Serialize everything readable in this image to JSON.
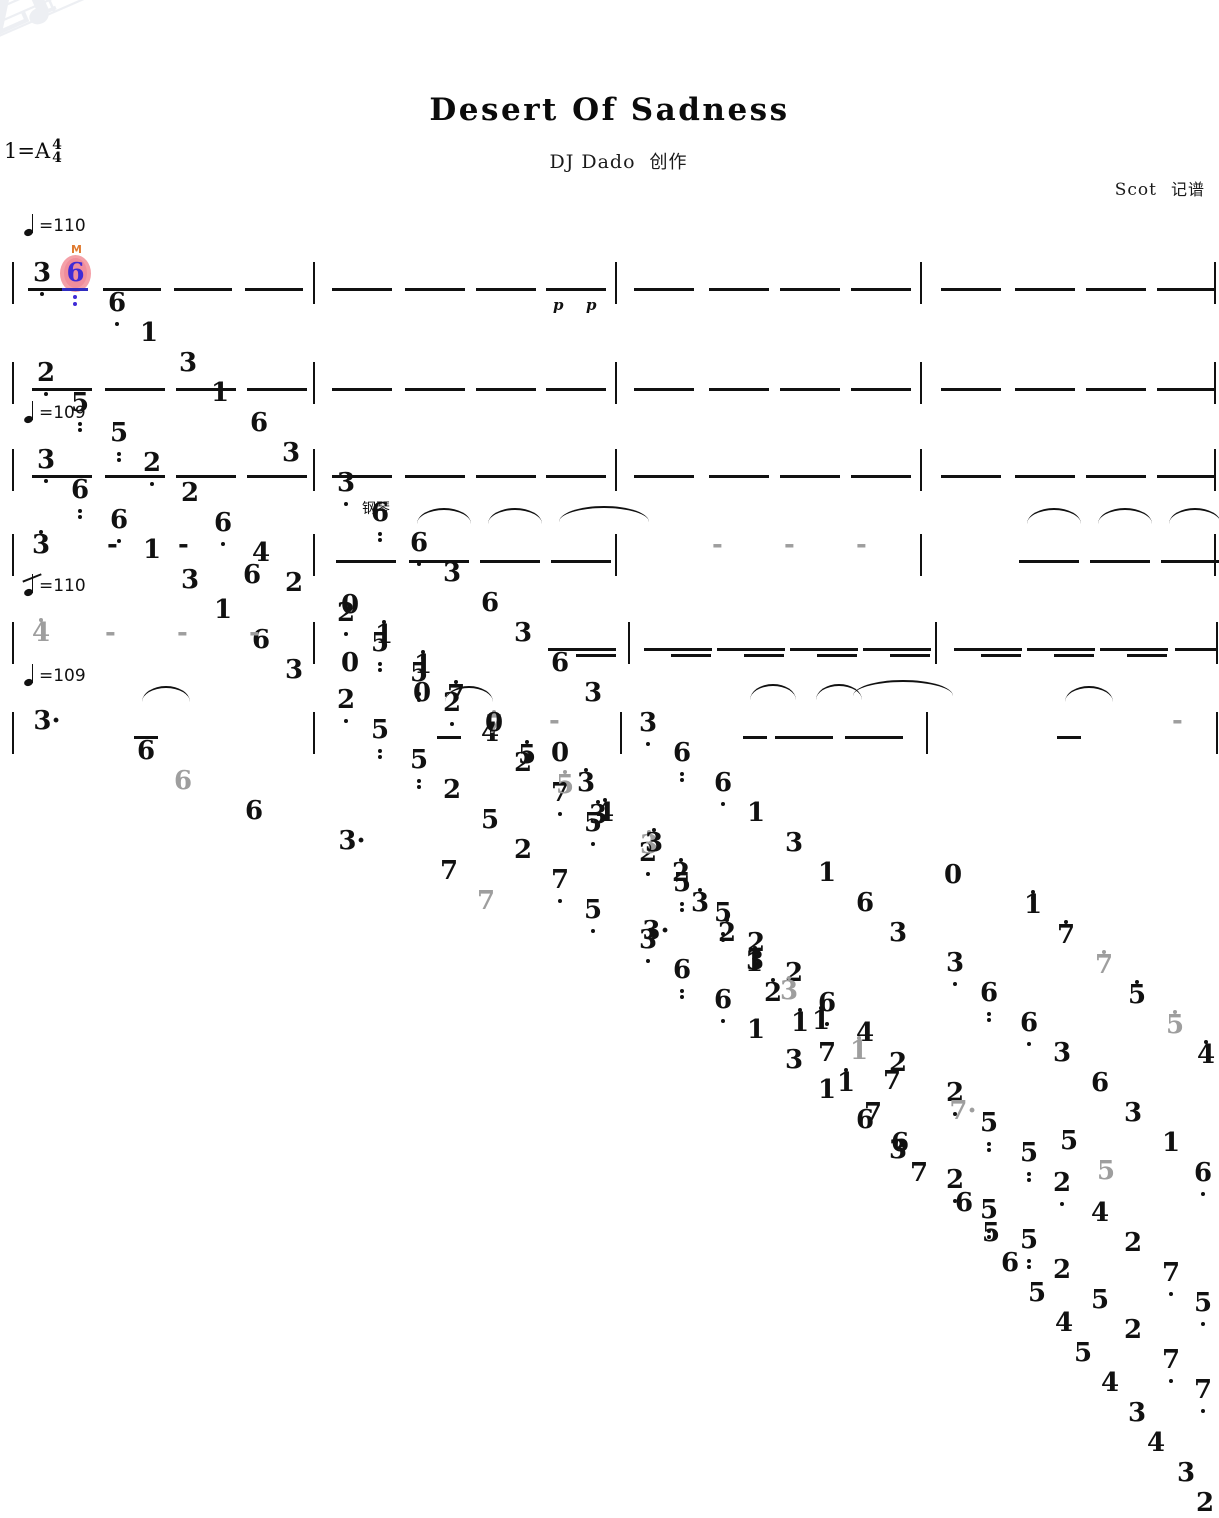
{
  "document": {
    "type": "numbered-musical-notation",
    "title": "Desert Of Sadness",
    "composer": "DJ Dado",
    "composer_role": "创作",
    "arranger": "Scot",
    "arranger_role": "记谱",
    "key_signature": "1=A",
    "time_signature_numerator": "4",
    "time_signature_denominator": "4",
    "instrument_label": "钢琴",
    "watermark": "watermark-logo"
  },
  "tempo_marks": [
    {
      "row": 1,
      "value": "=110"
    },
    {
      "row": 3,
      "value": "=109"
    },
    {
      "row": 5,
      "value": "=110"
    },
    {
      "row": 6,
      "value": "=109"
    }
  ],
  "colors": {
    "ink": "#111111",
    "ghost_note": "#9e9e9e",
    "highlight_fill": "#f4a0a8",
    "highlight_text": "#3f2bd6",
    "highlight_marker": "#e07a2f"
  },
  "rows": [
    {
      "id": "row-1",
      "measures": [
        {
          "notes": [
            "3",
            "6",
            "6",
            "1",
            "3",
            "1",
            "6",
            "3"
          ]
        },
        {
          "notes": [
            "3",
            "6",
            "6",
            "3",
            "6",
            "3",
            "6",
            "3"
          ],
          "dynamics": [
            "p",
            "p"
          ]
        },
        {
          "notes": [
            "3",
            "6",
            "6",
            "1",
            "3",
            "1",
            "6",
            "3"
          ]
        },
        {
          "notes": [
            "3",
            "6",
            "6",
            "3",
            "6",
            "3",
            "1",
            "6"
          ]
        }
      ]
    },
    {
      "id": "row-2",
      "measures": [
        {
          "notes": [
            "2",
            "5",
            "5",
            "2",
            "2",
            "6",
            "4",
            "2"
          ]
        },
        {
          "notes": [
            "2",
            "5",
            "5",
            "2",
            "4",
            "2",
            "7",
            "5"
          ]
        },
        {
          "notes": [
            "2",
            "5",
            "5",
            "2",
            "2",
            "6",
            "4",
            "2"
          ]
        },
        {
          "notes": [
            "2",
            "5",
            "5",
            "2",
            "4",
            "2",
            "7",
            "5"
          ]
        }
      ]
    },
    {
      "id": "row-3",
      "measures": [
        {
          "notes": [
            "3",
            "6",
            "6",
            "1",
            "3",
            "1",
            "6",
            "3"
          ]
        },
        {
          "notes": [
            "2",
            "5",
            "5",
            "2",
            "5",
            "2",
            "7",
            "5"
          ]
        },
        {
          "notes": [
            "3",
            "6",
            "6",
            "1",
            "3",
            "1",
            "6",
            "3"
          ]
        },
        {
          "notes": [
            "2",
            "5",
            "5",
            "2",
            "5",
            "2",
            "7",
            "7"
          ]
        }
      ]
    },
    {
      "id": "row-4",
      "measures": [
        {
          "notes": [
            "3",
            "-",
            "-",
            "6"
          ]
        },
        {
          "notes": [
            "0",
            "1",
            "1",
            "7",
            "7",
            "5",
            "5",
            "3"
          ]
        },
        {
          "notes": [
            "3",
            "-",
            "-",
            "-"
          ]
        },
        {
          "notes": [
            "0",
            "1",
            "7",
            "7",
            "5",
            "5",
            "4"
          ]
        }
      ]
    },
    {
      "id": "row-5",
      "measures": [
        {
          "notes": [
            "4",
            "-",
            "-",
            "-"
          ]
        },
        {
          "notes": [
            "0",
            "0",
            "0",
            "0",
            "3",
            "4"
          ]
        },
        {
          "notes": [
            "3",
            "2",
            "3",
            "2",
            "1",
            "2",
            "1",
            "7",
            "1",
            "7",
            "6",
            "7"
          ]
        },
        {
          "notes": [
            "6",
            "5",
            "6",
            "5",
            "4",
            "5",
            "4",
            "3",
            "4",
            "3",
            "2"
          ]
        }
      ]
    },
    {
      "id": "row-6",
      "measures": [
        {
          "notes": [
            "3·",
            "6",
            "6",
            "6"
          ]
        },
        {
          "notes": [
            "3·",
            "7",
            "7",
            "-"
          ]
        },
        {
          "notes": [
            "3·",
            "3",
            "3",
            "1",
            "1",
            "7"
          ]
        },
        {
          "notes": [
            "7·",
            "5",
            "5",
            "-"
          ]
        }
      ]
    }
  ],
  "cursor": {
    "note": "6",
    "marker": "M",
    "row": 1,
    "measure": 1,
    "index": 1
  }
}
